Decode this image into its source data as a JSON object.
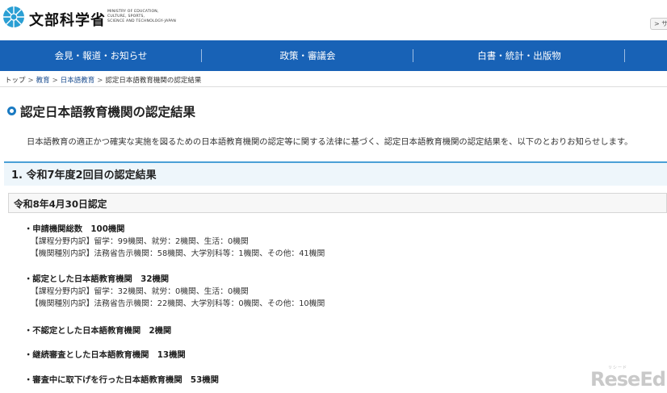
{
  "header": {
    "logo_name": "文部科学省",
    "logo_en_lines": [
      "MINISTRY OF EDUCATION,",
      "CULTURE, SPORTS,",
      "SCIENCE AND TECHNOLOGY-JAPAN"
    ],
    "side_button": "> サ"
  },
  "gnav": {
    "items": [
      "会見・報道・お知らせ",
      "政策・審議会",
      "白書・統計・出版物",
      ""
    ]
  },
  "breadcrumb": {
    "items": [
      "トップ",
      "教育",
      "日本語教育",
      "認定日本語教育機関の認定結果"
    ],
    "separator": ">"
  },
  "main": {
    "title": "認定日本語教育機関の認定結果",
    "intro": "日本語教育の適正かつ確実な実施を図るための日本語教育機関の認定等に関する法律に基づく、認定日本語教育機関の認定結果を、以下のとおりお知らせします。",
    "section_title": "1. 令和7年度2回目の認定結果",
    "sub_title": "令和8年4月30日認定",
    "items": [
      {
        "head": "・申請機関総数　100機関",
        "lines": [
          "【課程分野内訳】留学：99機関、就労：2機関、生活：0機関",
          "【機関種別内訳】法務省告示機関：58機関、大学別科等：1機関、その他：41機関"
        ]
      },
      {
        "head": "・認定とした日本語教育機関　32機関",
        "lines": [
          "【課程分野内訳】留学：32機関、就労：0機関、生活：0機関",
          "【機関種別内訳】法務省告示機関：22機関、大学別科等：0機関、その他：10機関"
        ]
      },
      {
        "head": "・不認定とした日本語教育機関　2機関",
        "lines": []
      },
      {
        "head": "・継続審査とした日本語教育機関　13機関",
        "lines": []
      },
      {
        "head": "・審査中に取下げを行った日本語教育機関　53機関",
        "lines": []
      }
    ]
  },
  "watermark": {
    "text": "ReseEd",
    "small": "リシード"
  },
  "colors": {
    "nav_bg": "#1862b6",
    "accent": "#1a7ac2",
    "section_bg": "#eef6fb"
  }
}
